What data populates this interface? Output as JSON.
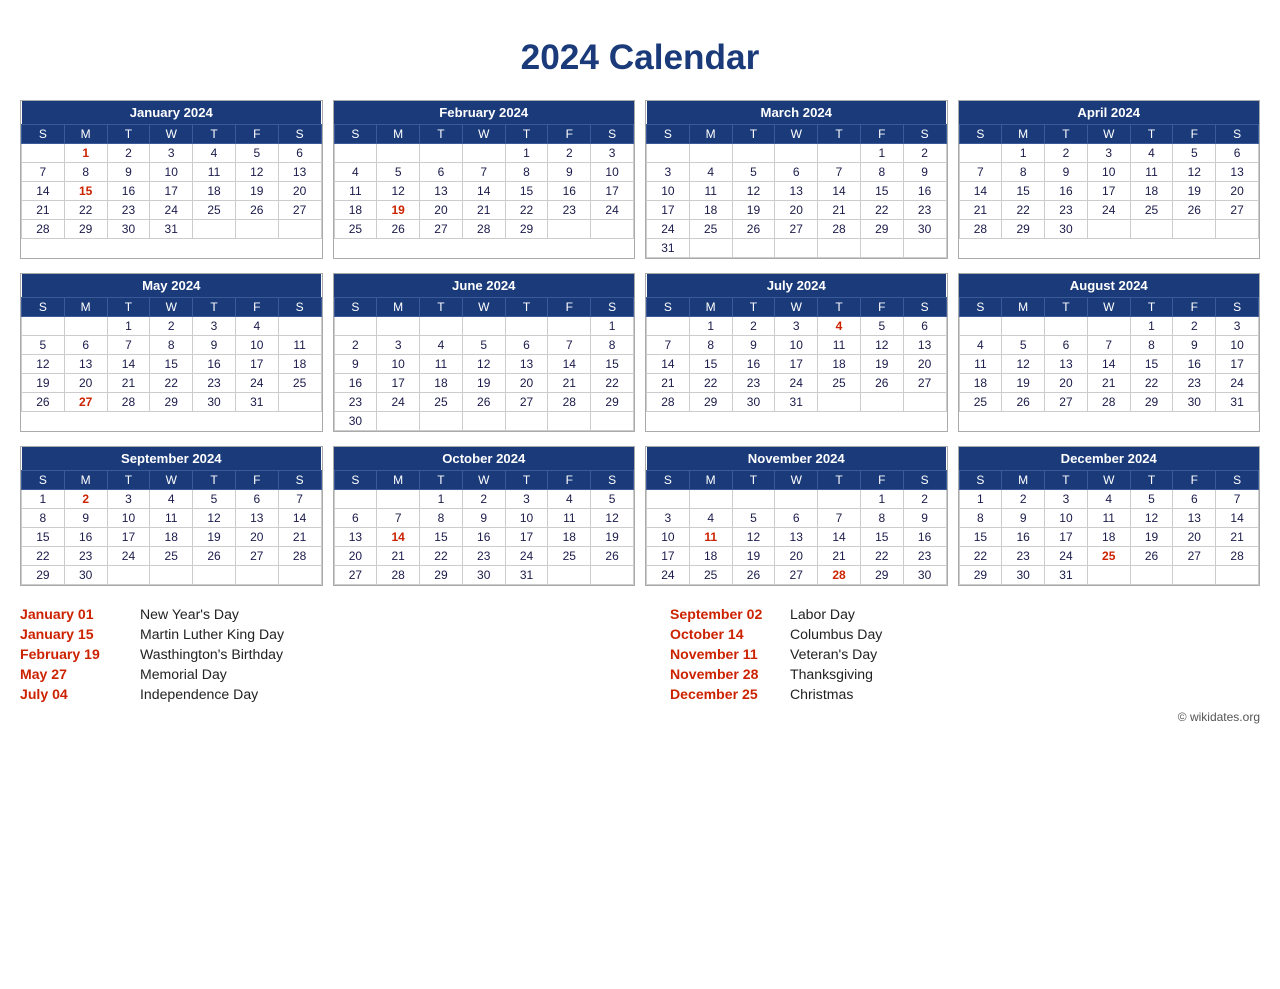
{
  "title": "2024 Calendar",
  "months": [
    {
      "name": "January 2024",
      "days": [
        [
          "",
          "1r",
          "2",
          "3",
          "4",
          "5",
          "6"
        ],
        [
          "7",
          "8",
          "9",
          "10",
          "11",
          "12",
          "13"
        ],
        [
          "14",
          "15r",
          "16",
          "17",
          "18",
          "19",
          "20"
        ],
        [
          "21",
          "22",
          "23",
          "24",
          "25",
          "26",
          "27"
        ],
        [
          "28",
          "29",
          "30",
          "31",
          "",
          "",
          ""
        ]
      ]
    },
    {
      "name": "February 2024",
      "days": [
        [
          "",
          "",
          "",
          "",
          "1",
          "2",
          "3"
        ],
        [
          "4",
          "5",
          "6",
          "7",
          "8",
          "9",
          "10"
        ],
        [
          "11",
          "12",
          "13",
          "14",
          "15",
          "16",
          "17"
        ],
        [
          "18",
          "19r",
          "20",
          "21",
          "22",
          "23",
          "24"
        ],
        [
          "25",
          "26",
          "27",
          "28",
          "29",
          "",
          ""
        ]
      ]
    },
    {
      "name": "March 2024",
      "days": [
        [
          "",
          "",
          "",
          "",
          "",
          "1",
          "2"
        ],
        [
          "3",
          "4",
          "5",
          "6",
          "7",
          "8",
          "9"
        ],
        [
          "10",
          "11",
          "12",
          "13",
          "14",
          "15",
          "16"
        ],
        [
          "17",
          "18",
          "19",
          "20",
          "21",
          "22",
          "23"
        ],
        [
          "24",
          "25",
          "26",
          "27",
          "28",
          "29",
          "30"
        ],
        [
          "31",
          "",
          "",
          "",
          "",
          "",
          ""
        ]
      ]
    },
    {
      "name": "April 2024",
      "days": [
        [
          "",
          "1",
          "2",
          "3",
          "4",
          "5",
          "6"
        ],
        [
          "7",
          "8",
          "9",
          "10",
          "11",
          "12",
          "13"
        ],
        [
          "14",
          "15",
          "16",
          "17",
          "18",
          "19",
          "20"
        ],
        [
          "21",
          "22",
          "23",
          "24",
          "25",
          "26",
          "27"
        ],
        [
          "28",
          "29",
          "30",
          "",
          "",
          "",
          ""
        ]
      ]
    },
    {
      "name": "May 2024",
      "days": [
        [
          "",
          "",
          "1",
          "2",
          "3",
          "4",
          ""
        ],
        [
          "5",
          "6",
          "7",
          "8",
          "9",
          "10",
          "11"
        ],
        [
          "12",
          "13",
          "14",
          "15",
          "16",
          "17",
          "18"
        ],
        [
          "19",
          "20",
          "21",
          "22",
          "23",
          "24",
          "25"
        ],
        [
          "26",
          "27r",
          "28",
          "29",
          "30",
          "31",
          ""
        ]
      ]
    },
    {
      "name": "June 2024",
      "days": [
        [
          "",
          "",
          "",
          "",
          "",
          "",
          "1"
        ],
        [
          "2",
          "3",
          "4",
          "5",
          "6",
          "7",
          "8"
        ],
        [
          "9",
          "10",
          "11",
          "12",
          "13",
          "14",
          "15"
        ],
        [
          "16",
          "17",
          "18",
          "19",
          "20",
          "21",
          "22"
        ],
        [
          "23",
          "24",
          "25",
          "26",
          "27",
          "28",
          "29"
        ],
        [
          "30",
          "",
          "",
          "",
          "",
          "",
          ""
        ]
      ]
    },
    {
      "name": "July 2024",
      "days": [
        [
          "",
          "1",
          "2",
          "3",
          "4r",
          "5",
          "6"
        ],
        [
          "7",
          "8",
          "9",
          "10",
          "11",
          "12",
          "13"
        ],
        [
          "14",
          "15",
          "16",
          "17",
          "18",
          "19",
          "20"
        ],
        [
          "21",
          "22",
          "23",
          "24",
          "25",
          "26",
          "27"
        ],
        [
          "28",
          "29",
          "30",
          "31",
          "",
          "",
          ""
        ]
      ]
    },
    {
      "name": "August 2024",
      "days": [
        [
          "",
          "",
          "",
          "",
          "1",
          "2",
          "3"
        ],
        [
          "4",
          "5",
          "6",
          "7",
          "8",
          "9",
          "10"
        ],
        [
          "11",
          "12",
          "13",
          "14",
          "15",
          "16",
          "17"
        ],
        [
          "18",
          "19",
          "20",
          "21",
          "22",
          "23",
          "24"
        ],
        [
          "25",
          "26",
          "27",
          "28",
          "29",
          "30",
          "31"
        ]
      ]
    },
    {
      "name": "September 2024",
      "days": [
        [
          "1",
          "2r",
          "3",
          "4",
          "5",
          "6",
          "7"
        ],
        [
          "8",
          "9",
          "10",
          "11",
          "12",
          "13",
          "14"
        ],
        [
          "15",
          "16",
          "17",
          "18",
          "19",
          "20",
          "21"
        ],
        [
          "22",
          "23",
          "24",
          "25",
          "26",
          "27",
          "28"
        ],
        [
          "29",
          "30",
          "",
          "",
          "",
          "",
          ""
        ]
      ]
    },
    {
      "name": "October 2024",
      "days": [
        [
          "",
          "",
          "1",
          "2",
          "3",
          "4",
          "5"
        ],
        [
          "6",
          "7",
          "8",
          "9",
          "10",
          "11",
          "12"
        ],
        [
          "13",
          "14r",
          "15",
          "16",
          "17",
          "18",
          "19"
        ],
        [
          "20",
          "21",
          "22",
          "23",
          "24",
          "25",
          "26"
        ],
        [
          "27",
          "28",
          "29",
          "30",
          "31",
          "",
          ""
        ]
      ]
    },
    {
      "name": "November 2024",
      "days": [
        [
          "",
          "",
          "",
          "",
          "",
          "1",
          "2"
        ],
        [
          "3",
          "4",
          "5",
          "6",
          "7",
          "8",
          "9"
        ],
        [
          "10",
          "11r",
          "12",
          "13",
          "14",
          "15",
          "16"
        ],
        [
          "17",
          "18",
          "19",
          "20",
          "21",
          "22",
          "23"
        ],
        [
          "24",
          "25",
          "26",
          "27",
          "28r",
          "29",
          "30"
        ]
      ]
    },
    {
      "name": "December 2024",
      "days": [
        [
          "1",
          "2",
          "3",
          "4",
          "5",
          "6",
          "7"
        ],
        [
          "8",
          "9",
          "10",
          "11",
          "12",
          "13",
          "14"
        ],
        [
          "15",
          "16",
          "17",
          "18",
          "19",
          "20",
          "21"
        ],
        [
          "22",
          "23",
          "24",
          "25r",
          "26",
          "27",
          "28"
        ],
        [
          "29",
          "30",
          "31",
          "",
          "",
          "",
          ""
        ]
      ]
    }
  ],
  "weekdays": [
    "S",
    "M",
    "T",
    "W",
    "T",
    "F",
    "S"
  ],
  "holidays": [
    {
      "date": "January 01",
      "name": "New Year's Day"
    },
    {
      "date": "January 15",
      "name": "Martin Luther King Day"
    },
    {
      "date": "February 19",
      "name": "Wasthington's Birthday"
    },
    {
      "date": "May 27",
      "name": "Memorial Day"
    },
    {
      "date": "July 04",
      "name": "Independence Day"
    },
    {
      "date": "September 02",
      "name": "Labor Day"
    },
    {
      "date": "October 14",
      "name": "Columbus Day"
    },
    {
      "date": "November 11",
      "name": "Veteran's Day"
    },
    {
      "date": "November 28",
      "name": "Thanksgiving"
    },
    {
      "date": "December 25",
      "name": "Christmas"
    }
  ],
  "copyright": "© wikidates.org"
}
